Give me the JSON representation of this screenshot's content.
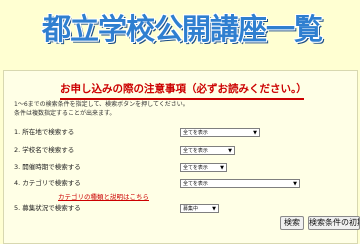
{
  "page": {
    "title": "都立学校公開講座一覧"
  },
  "notice": {
    "heading": "お申し込みの際の注意事項（必ずお読みください。）"
  },
  "intro": {
    "line1": "1〜6までの検索条件を指定して、検索ボタンを押してください。",
    "line2": "条件は複数指定することが出来ます。"
  },
  "filters": [
    {
      "label": "1. 所在地で検索する",
      "value": "全てを表示"
    },
    {
      "label": "2. 学校名で検索する",
      "value": "全てを表示"
    },
    {
      "label": "3. 開催時期で検索する",
      "value": "全てを表示"
    },
    {
      "label": "4. カテゴリで検索する",
      "value": "全てを表示"
    },
    {
      "label": "5. 募集状況で検索する",
      "value": "募集中"
    }
  ],
  "category_help_link": "カテゴリの種類と説明はこちら",
  "buttons": {
    "search": "検索",
    "reset": "検索条件の初期化"
  },
  "icons": {
    "dropdown_arrow": "▼"
  },
  "colors": {
    "background": "#ffffd2",
    "title": "#2f7fd0",
    "notice": "#cc0000"
  }
}
